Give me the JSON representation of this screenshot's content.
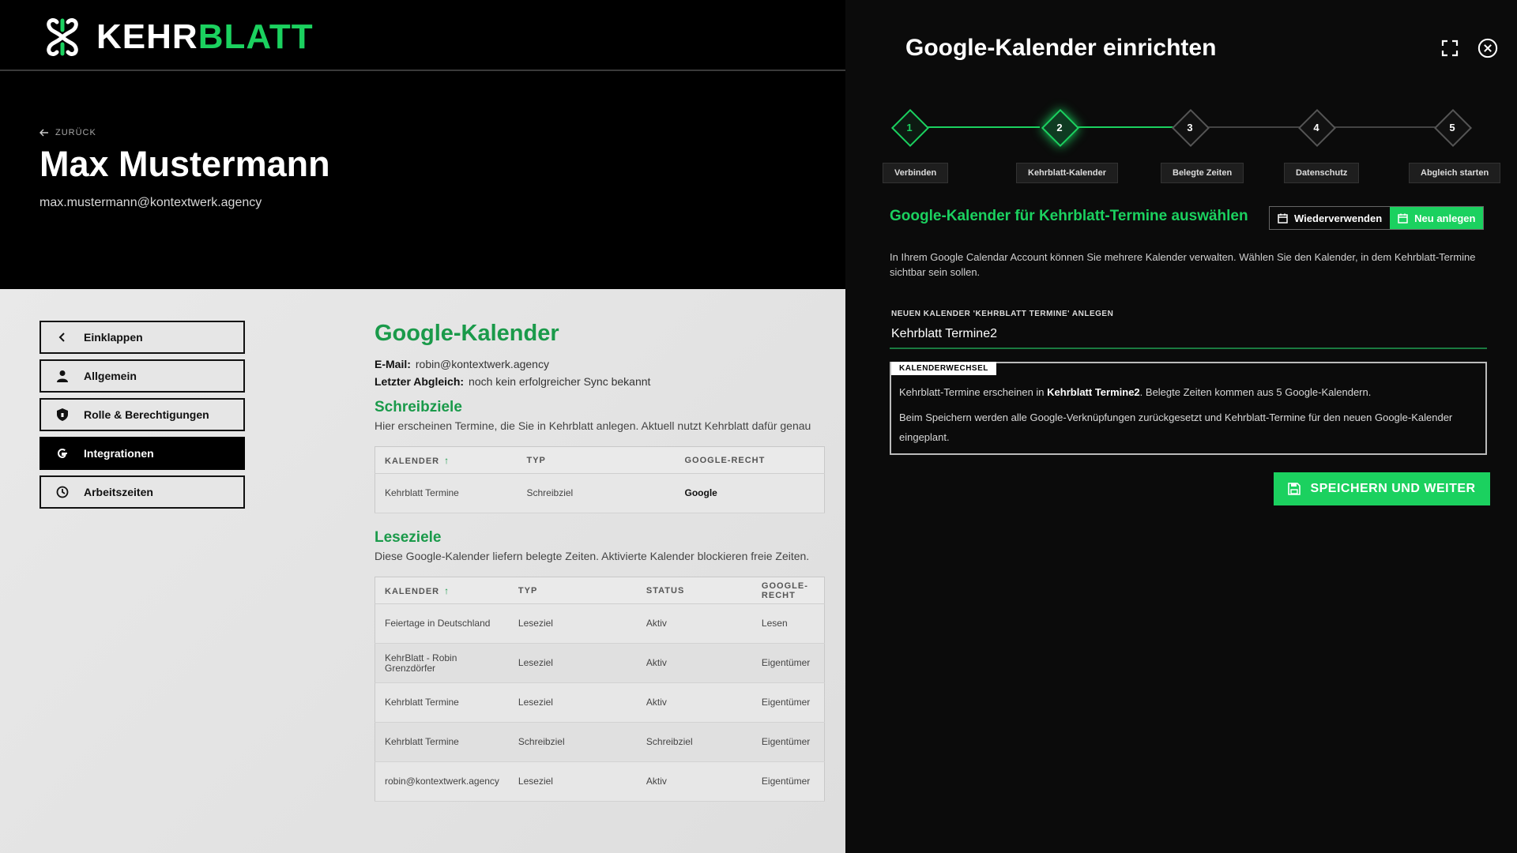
{
  "brand": {
    "logo_white": "KEHR",
    "logo_green": "BLATT",
    "green": "#1bd15f"
  },
  "hero": {
    "back_label": "ZURÜCK",
    "name": "Max Mustermann",
    "email": "max.mustermann@kontextwerk.agency"
  },
  "sidebar": {
    "items": [
      {
        "label": "Einklappen",
        "icon": "chevron-left-icon"
      },
      {
        "label": "Allgemein",
        "icon": "person-icon"
      },
      {
        "label": "Rolle & Berechtigungen",
        "icon": "shield-icon"
      },
      {
        "label": "Integrationen",
        "icon": "google-icon",
        "active": true
      },
      {
        "label": "Arbeitszeiten",
        "icon": "clock-icon"
      }
    ]
  },
  "main": {
    "title": "Google-Kalender",
    "email_label": "E-Mail:",
    "email_value": "robin@kontextwerk.agency",
    "sync_label": "Letzter Abgleich:",
    "sync_value": "noch kein erfolgreicher Sync bekannt",
    "write_title": "Schreibziele",
    "write_desc": "Hier erscheinen Termine, die Sie in Kehrblatt anlegen. Aktuell nutzt Kehrblatt dafür genau",
    "write_table": {
      "headers": [
        "KALENDER",
        "TYP",
        "GOOGLE-RECHT"
      ],
      "rows": [
        [
          "Kehrblatt Termine",
          "Schreibziel",
          "Google"
        ]
      ]
    },
    "read_title": "Leseziele",
    "read_desc": "Diese Google-Kalender liefern belegte Zeiten. Aktivierte Kalender blockieren freie Zeiten.",
    "read_table": {
      "headers": [
        "KALENDER",
        "TYP",
        "STATUS",
        "GOOGLE-RECHT"
      ],
      "rows": [
        [
          "Feiertage in Deutschland",
          "Leseziel",
          "Aktiv",
          "Lesen"
        ],
        [
          "KehrBlatt - Robin Grenzdörfer",
          "Leseziel",
          "Aktiv",
          "Eigentümer"
        ],
        [
          "Kehrblatt Termine",
          "Leseziel",
          "Aktiv",
          "Eigentümer"
        ],
        [
          "Kehrblatt Termine",
          "Schreibziel",
          "Schreibziel",
          "Eigentümer"
        ],
        [
          "robin@kontextwerk.agency",
          "Leseziel",
          "Aktiv",
          "Eigentümer"
        ]
      ]
    }
  },
  "modal": {
    "title": "Google-Kalender einrichten",
    "steps": [
      {
        "num": "1",
        "label": "Verbinden",
        "state": "done"
      },
      {
        "num": "2",
        "label": "Kehrblatt-Kalender",
        "state": "current"
      },
      {
        "num": "3",
        "label": "Belegte Zeiten",
        "state": "todo"
      },
      {
        "num": "4",
        "label": "Datenschutz",
        "state": "todo"
      },
      {
        "num": "5",
        "label": "Abgleich starten",
        "state": "todo"
      }
    ],
    "section_title": "Google-Kalender für Kehrblatt-Termine auswählen",
    "toggle_reuse": "Wiederverwenden",
    "toggle_new": "Neu anlegen",
    "intro": "In Ihrem Google Calendar Account können Sie mehrere Kalender verwalten. Wählen Sie den Kalender, in dem Kehrblatt-Termine sichtbar sein sollen.",
    "field_label": "NEUEN KALENDER 'KEHRBLATT TERMINE' ANLEGEN",
    "field_value": "Kehrblatt Termine2",
    "info_tag": "KALENDERWECHSEL",
    "info_p1_a": "Kehrblatt-Termine erscheinen in ",
    "info_p1_b": "Kehrblatt Termine2",
    "info_p1_c": ". Belegte Zeiten kommen aus 5 Google-Kalendern.",
    "info_p2": "Beim Speichern werden alle Google-Verknüpfungen zurückgesetzt und Kehrblatt-Termine für den neuen Google-Kalender eingeplant.",
    "save_label": "SPEICHERN UND WEITER"
  }
}
